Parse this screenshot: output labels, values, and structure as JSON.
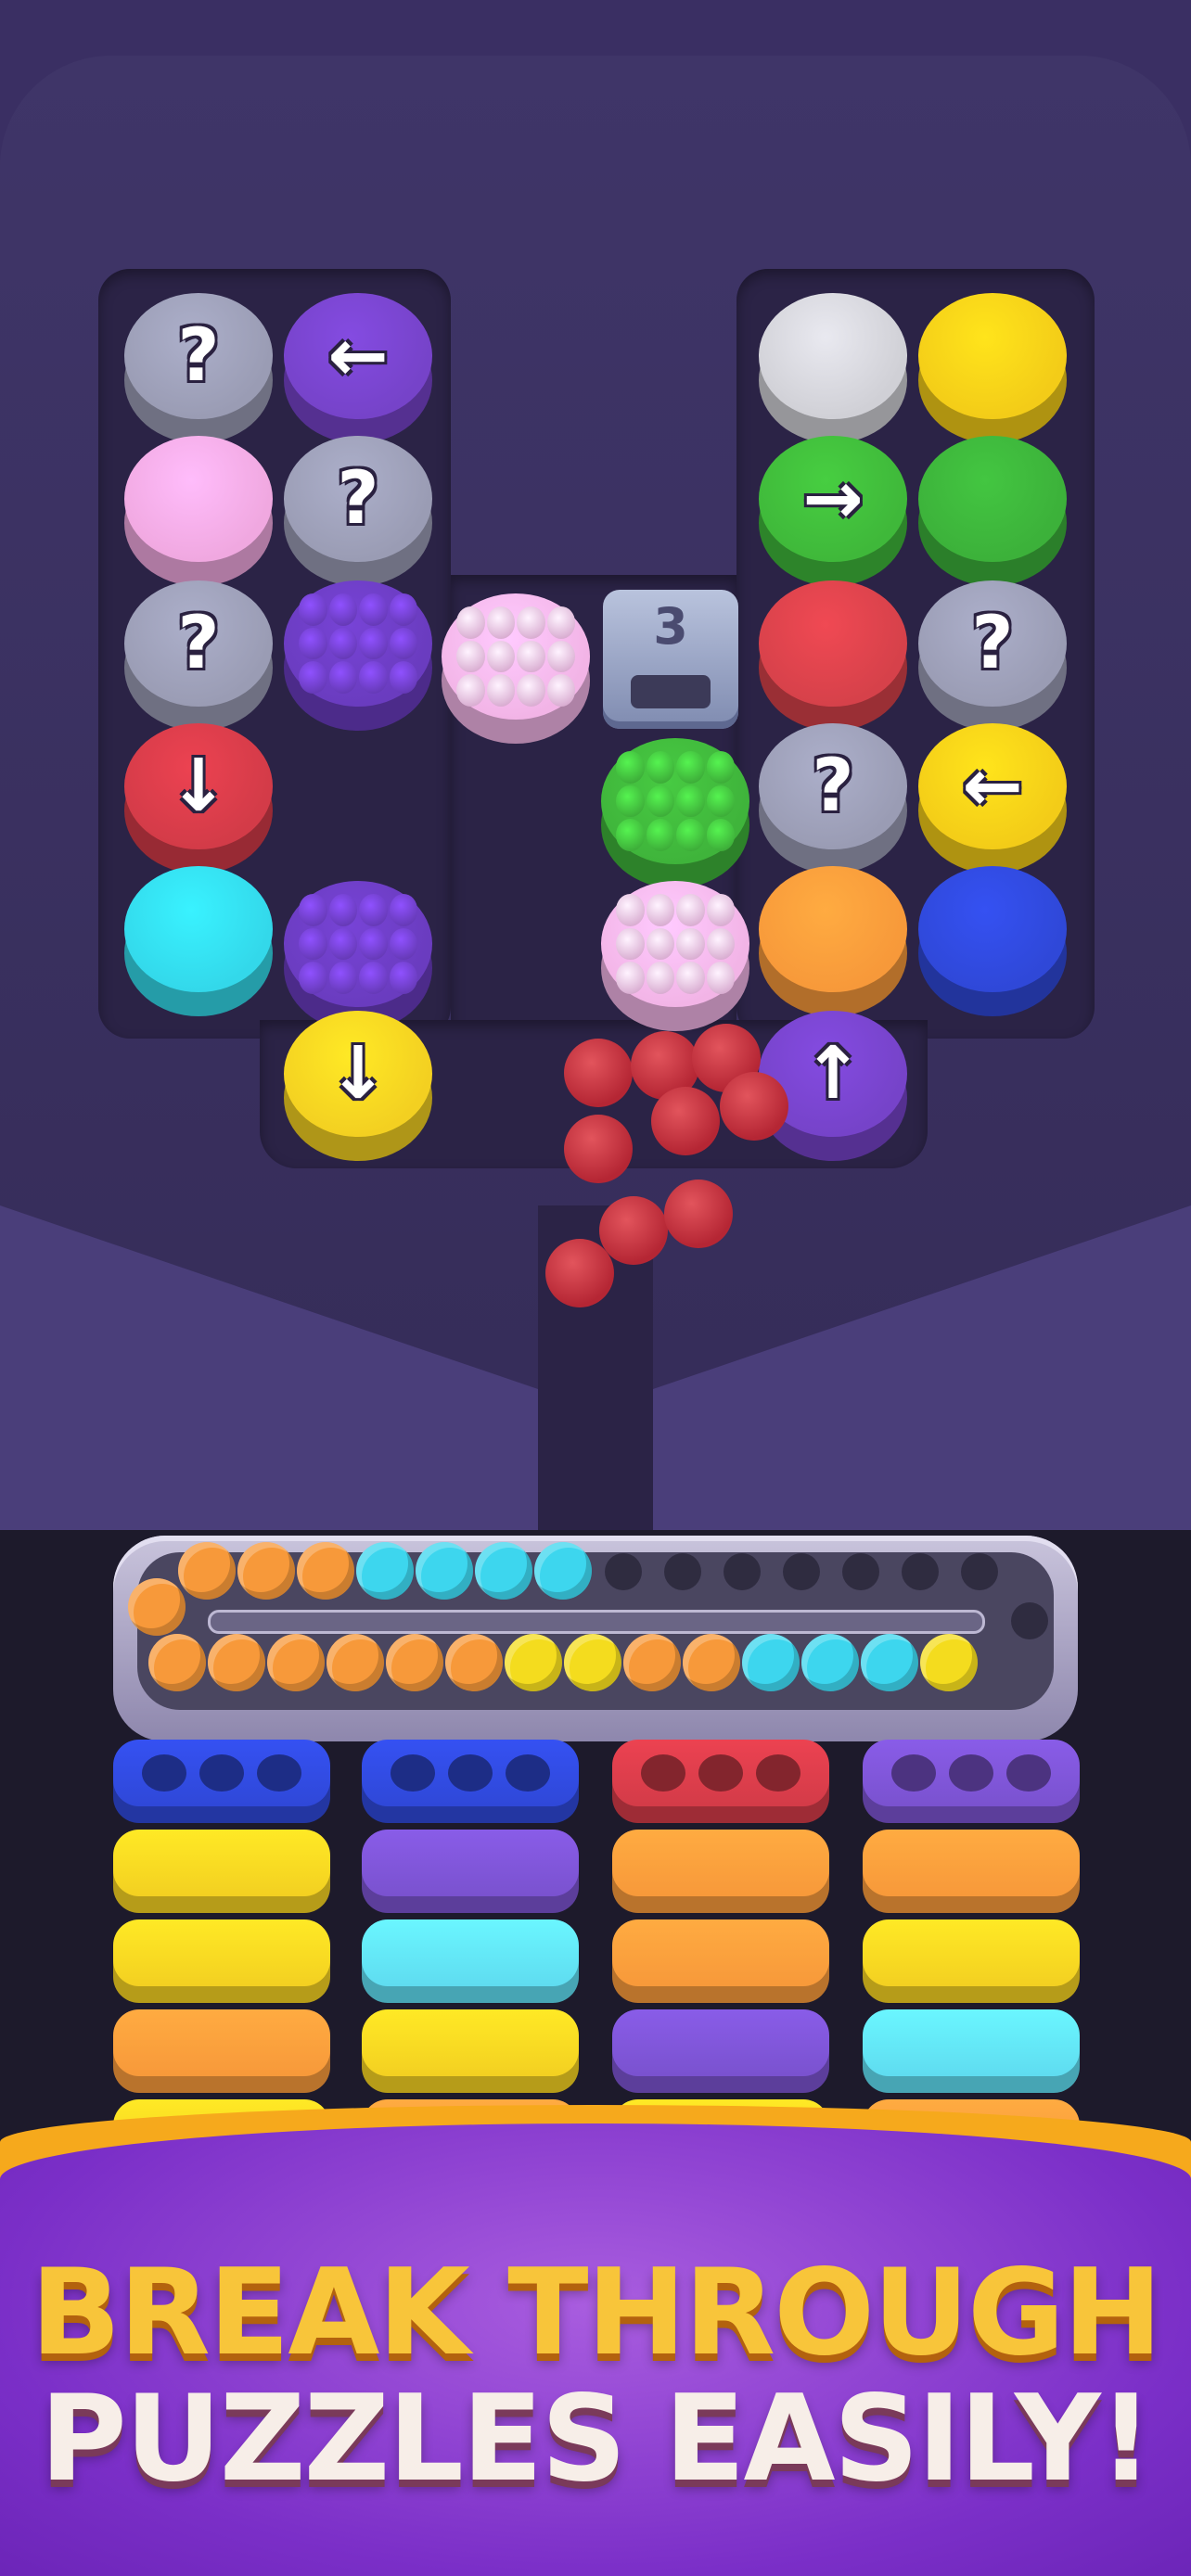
{
  "headline": {
    "line1": "BREAK THROUGH",
    "line2": "PUZZLES EASILY!"
  },
  "board": {
    "counter_block": {
      "value": "3",
      "icon": "box-counter-icon"
    },
    "discs": [
      {
        "id": "l-r1c1",
        "color": "#9a9cb4",
        "glyph": "?"
      },
      {
        "id": "l-r1c2",
        "color": "#7643c9",
        "glyph": "←"
      },
      {
        "id": "l-r2c1",
        "color": "#f0a8e0",
        "glyph": ""
      },
      {
        "id": "l-r2c2",
        "color": "#9a9cb4",
        "glyph": "?"
      },
      {
        "id": "l-r3c1",
        "color": "#9a9cb4",
        "glyph": "?"
      },
      {
        "id": "l-r3c2",
        "color": "#6a3cbf",
        "glyph": "studs"
      },
      {
        "id": "m-r3",
        "color": "#f2b4e6",
        "glyph": "studs"
      },
      {
        "id": "l-r4c1",
        "color": "#d33b48",
        "glyph": "↓"
      },
      {
        "id": "l-r5c1",
        "color": "#33d8ea",
        "glyph": ""
      },
      {
        "id": "l-r5c2",
        "color": "#6a3cbf",
        "glyph": "studs"
      },
      {
        "id": "l-r6c2",
        "color": "#f3d021",
        "glyph": "↓"
      },
      {
        "id": "r-r1c1",
        "color": "#d0d0d6",
        "glyph": ""
      },
      {
        "id": "r-r1c2",
        "color": "#f3cc18",
        "glyph": ""
      },
      {
        "id": "r-r2c1",
        "color": "#3fb83a",
        "glyph": "→"
      },
      {
        "id": "r-r2c2",
        "color": "#3cb13a",
        "glyph": ""
      },
      {
        "id": "r-r3c1",
        "color": "#d6414a",
        "glyph": ""
      },
      {
        "id": "r-r3c2",
        "color": "#9a9cb4",
        "glyph": "?"
      },
      {
        "id": "m-r4",
        "color": "#3fb43b",
        "glyph": "studs"
      },
      {
        "id": "r-r4c1",
        "color": "#9a9cb4",
        "glyph": "?"
      },
      {
        "id": "r-r4c2",
        "color": "#f3cc18",
        "glyph": "←"
      },
      {
        "id": "m-r5",
        "color": "#f2b4e6",
        "glyph": "studs"
      },
      {
        "id": "r-r5c1",
        "color": "#f7993a",
        "glyph": ""
      },
      {
        "id": "r-r5c2",
        "color": "#2f48d8",
        "glyph": ""
      },
      {
        "id": "r-r6c1",
        "color": "#7643c9",
        "glyph": "↑"
      }
    ]
  },
  "tray": {
    "top_row": [
      "orange",
      "orange",
      "orange",
      "cyan",
      "cyan",
      "cyan",
      "cyan",
      "empty",
      "empty",
      "empty",
      "empty",
      "empty",
      "empty",
      "empty"
    ],
    "bottom_row": [
      "orange",
      "orange",
      "orange",
      "orange",
      "orange",
      "orange",
      "yellow",
      "yellow",
      "orange",
      "orange",
      "cyan",
      "cyan",
      "cyan",
      "yellow"
    ]
  },
  "columns": [
    {
      "name": "column-1",
      "stack": [
        "#2f48d8",
        "#f3d021",
        "#f3d021",
        "#f7993a",
        "#f3d021"
      ]
    },
    {
      "name": "column-2",
      "stack": [
        "#2f48d8",
        "#7a52cf",
        "#5fdcf0",
        "#f3d021",
        "#f7993a"
      ]
    },
    {
      "name": "column-3",
      "stack": [
        "#d33b48",
        "#f7993a",
        "#f7993a",
        "#7a52cf",
        "#f3d021"
      ]
    },
    {
      "name": "column-4",
      "stack": [
        "#7a52cf",
        "#f7993a",
        "#f3d021",
        "#5fdcf0",
        "#f7993a"
      ]
    }
  ],
  "colors": {
    "orange": "#f7993a",
    "cyan": "#3dd6ee",
    "yellow": "#f4dc1e",
    "banner": "#7b2fc8",
    "headline_gold": "#f8c53a"
  }
}
